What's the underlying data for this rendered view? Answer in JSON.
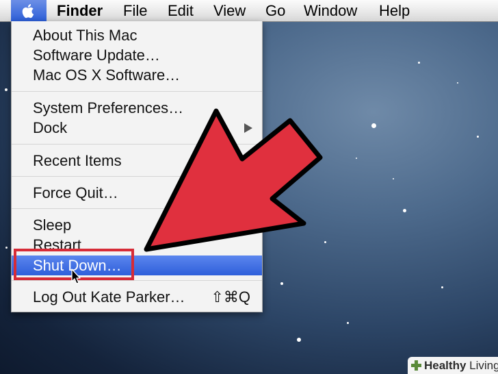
{
  "menubar": {
    "items": [
      "Finder",
      "File",
      "Edit",
      "View",
      "Go",
      "Window",
      "Help"
    ]
  },
  "apple_menu": {
    "items": [
      {
        "label": "About This Mac"
      },
      {
        "label": "Software Update…"
      },
      {
        "label": "Mac OS X Software…"
      },
      {
        "label": "System Preferences…"
      },
      {
        "label": "Dock",
        "has_submenu": true
      },
      {
        "label": "Recent Items"
      },
      {
        "label": "Force Quit…"
      },
      {
        "label": "Sleep"
      },
      {
        "label": "Restart"
      },
      {
        "label": "Shut Down…",
        "highlighted": true
      },
      {
        "label": "Log Out Kate Parker…",
        "shortcut": "⇧⌘Q"
      }
    ]
  },
  "watermark": {
    "prefix": "Healthy",
    "suffix": " Living"
  },
  "colors": {
    "highlight": "#3a69e0",
    "annotation_red": "#d62b37",
    "arrow_fill": "#e0303e"
  },
  "icons": {
    "apple": "apple-logo-icon",
    "submenu": "submenu-arrow-icon",
    "cursor": "mouse-pointer-icon",
    "watermark": "plus-leaf-icon"
  }
}
